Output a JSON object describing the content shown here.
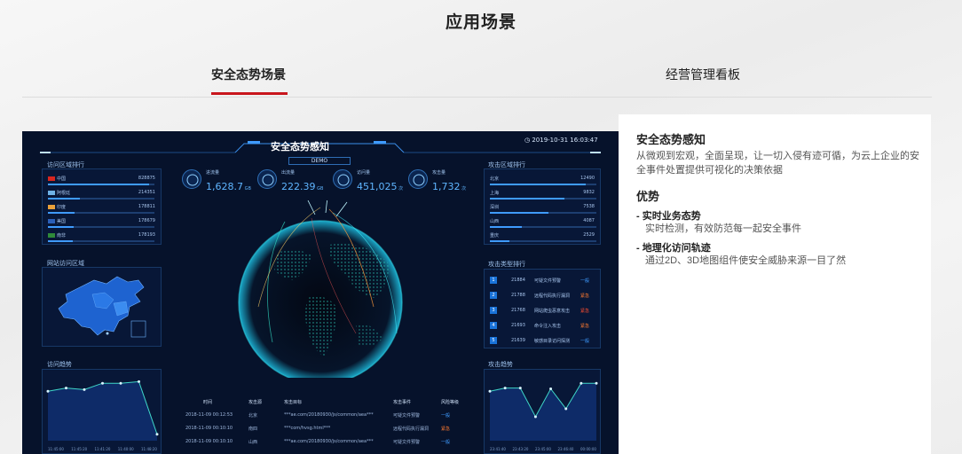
{
  "page": {
    "title": "应用场景"
  },
  "tabs": [
    {
      "label": "安全态势场景",
      "active": true
    },
    {
      "label": "经营管理看板",
      "active": false
    }
  ],
  "dashboard": {
    "title": "安全态势感知",
    "demo_label": "DEMO",
    "datetime": "2019-10-31 16:03:47",
    "visit_region_rank": {
      "title": "访问区域排行",
      "rows": [
        {
          "name": "中国",
          "value": "828875",
          "fill": 0.95
        },
        {
          "name": "阿根廷",
          "value": "214351",
          "fill": 0.3
        },
        {
          "name": "印度",
          "value": "178811",
          "fill": 0.25
        },
        {
          "name": "美国",
          "value": "178679",
          "fill": 0.24
        },
        {
          "name": "南非",
          "value": "178193",
          "fill": 0.23
        }
      ]
    },
    "site_visit_region": {
      "title": "网站访问区域"
    },
    "visit_trend": {
      "title": "访问趋势",
      "ticks": [
        "11:45:00",
        "11:45:20",
        "11:41:20",
        "11:40:00",
        "11:48:20"
      ],
      "values": [
        62,
        66,
        64,
        72,
        72,
        74,
        8
      ]
    },
    "kpis": [
      {
        "label": "进流量",
        "value": "1,628.7",
        "unit": "GB",
        "icon": "heartbeat-icon"
      },
      {
        "label": "出流量",
        "value": "222.39",
        "unit": "GB",
        "icon": "document-icon"
      },
      {
        "label": "访问量",
        "value": "451,025",
        "unit": "次",
        "icon": "users-icon"
      },
      {
        "label": "攻击量",
        "value": "1,732",
        "unit": "次",
        "icon": "lightning-icon"
      }
    ],
    "attack_region_rank": {
      "title": "攻击区域排行",
      "rows": [
        {
          "name": "北京",
          "value": "12490",
          "fill": 0.9
        },
        {
          "name": "上海",
          "value": "9832",
          "fill": 0.7
        },
        {
          "name": "深圳",
          "value": "7538",
          "fill": 0.55
        },
        {
          "name": "山西",
          "value": "4087",
          "fill": 0.3
        },
        {
          "name": "重庆",
          "value": "2529",
          "fill": 0.18
        }
      ]
    },
    "attack_type_rank": {
      "title": "攻击类型排行",
      "rows": [
        {
          "rank": "1",
          "count": "21884",
          "type": "可疑文件预警",
          "level": "一般",
          "level_color": "#3f9bff"
        },
        {
          "rank": "2",
          "count": "21788",
          "type": "远程代码执行漏洞",
          "level": "紧急",
          "level_color": "#ff7a2f"
        },
        {
          "rank": "3",
          "count": "21768",
          "type": "网站爬虫恶意攻击",
          "level": "紧急",
          "level_color": "#ff4d2f"
        },
        {
          "rank": "4",
          "count": "21693",
          "type": "命令注入攻击",
          "level": "紧急",
          "level_color": "#ff7a2f"
        },
        {
          "rank": "5",
          "count": "21639",
          "type": "敏感目录访问探测",
          "level": "一般",
          "level_color": "#3f9bff"
        }
      ]
    },
    "attack_trend": {
      "title": "攻击趋势",
      "ticks": [
        "23:41:40",
        "23:43:20",
        "23:45:00",
        "23:46:40",
        "00:00:00"
      ],
      "values": [
        62,
        66,
        66,
        30,
        65,
        40,
        72,
        72
      ]
    },
    "table": {
      "headers": [
        "时间",
        "攻击源",
        "攻击目标",
        "攻击事件",
        "风险等级"
      ],
      "rows": [
        [
          "2018-11-09 00:12:53",
          "北京",
          "***ae.com/20180930/js/common/aea***",
          "可疑文件预警",
          "一般"
        ],
        [
          "2018-11-09 00:10:10",
          "南四",
          "***com/hvsg.html***",
          "远程代码执行漏洞",
          "紧急"
        ],
        [
          "2018-11-09 00:10:10",
          "山西",
          "***ae.com/20180930/js/common/aea***",
          "可疑文件预警",
          "一般"
        ]
      ],
      "level_colors": [
        "#3f9bff",
        "#ff7a2f",
        "#3f9bff"
      ]
    }
  },
  "card": {
    "title": "安全态势感知",
    "description": "从微观到宏观，全面呈现，让一切入侵有迹可循，为云上企业的安全事件处置提供可视化的决策依据",
    "advantages_title": "优势",
    "advantages": [
      {
        "title": "实时业务态势",
        "desc": "实时检测，有效防范每一起安全事件"
      },
      {
        "title": "地理化访问轨迹",
        "desc": "通过2D、3D地图组件使安全威胁来源一目了然"
      }
    ]
  }
}
